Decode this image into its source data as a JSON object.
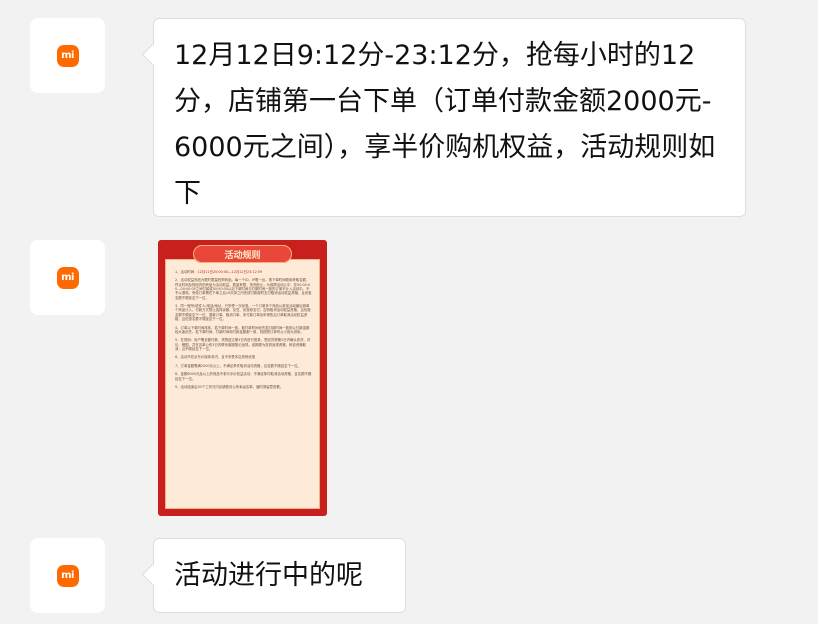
{
  "messages": [
    {
      "sender_avatar": "mi-logo-icon",
      "text": "12月12日9:12分-23:12分，抢每小时的12分，店铺第一台下单（订单付款金额2000元-6000元之间），享半价购机权益，活动规则如下"
    },
    {
      "sender_avatar": "mi-logo-icon",
      "image": {
        "title": "活动规则",
        "rules": [
          {
            "label": "1、活动时间：",
            "text": "12月11日20:00:00—12月12日23:12:59"
          },
          {
            "text": "2、活动权益商品为限时限量抢购商品。每一个ID、IP限一台。按下单时间顺序获取名额，符合时间及规则内的商品为活动权益。数量有限，抢完即止；为保障活动公平，在00:00:00—00:00:05之间付款或00:00:05以后下单时间与付款时间一致的订单不计入活动中。不予以退现。有效订单需在下单之后10分钟之内完成付款超时支付取消活动权益资格。且优惠名额不顺延至下一位。"
          },
          {
            "text": "3、同一账号/收件人/电话/地址，只享受一次优惠。一个订单多个商品以参加活动最后首单个商品计入。付款方式禁止选择余额、京豆、优惠券支付，否则取消活动权益资格，且优惠名额不顺延至下一位。退款订单、取消订单、未付款订单及申请售后订单取消活动权益资格，且优惠名额不顺延至下一位。"
          },
          {
            "text": "4、订单以下单时间排序，若下单时间一致，取付款时间优先若付款时间一致则以付款金额较大者优先。若下单时间、付款时间和付款金额都一致，则按照订单号从小到大排序。"
          },
          {
            "text": "5、在规则：用户需全额付款，货物送达第3日内进行登录，签收货物第3日内确认收货、评论、晒图，并在名单公布3日内联系客服登记返现。逾期视为放弃返现资格，即该资格取消，且不顺延至下一位。"
          },
          {
            "text": "6、活动不在京东价保体系内，且不享受本店其他优惠"
          },
          {
            "text": "7、订单金额需满2000元以上。不满足条件取消活动资格，且名额不顺延至下一位。"
          },
          {
            "text": "8、金额6000元及以上的商品不参与半价权益活动，不满足条件取消活动资格，且名额不顺延至下一位。"
          },
          {
            "text": "9、活动结束后30个工作日内店铺首页公布幸运名单，届时请留意查看。"
          }
        ]
      }
    },
    {
      "sender_avatar": "mi-logo-icon",
      "text": "活动进行中的呢"
    }
  ],
  "colors": {
    "background": "#f2f2f2",
    "bubble": "#ffffff",
    "brand_orange": "#ff6900",
    "poster_red": "#c8211d"
  }
}
